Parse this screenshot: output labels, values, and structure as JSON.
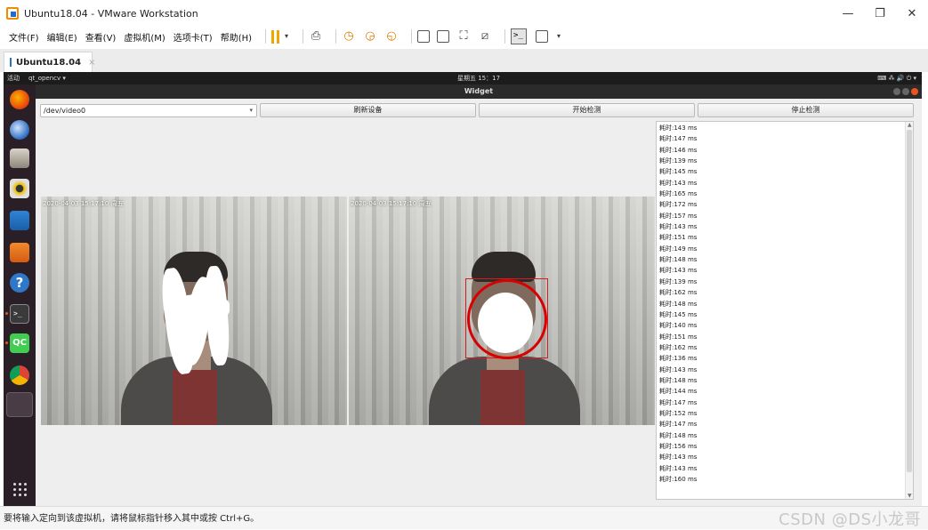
{
  "vmware": {
    "title": "Ubuntu18.04 - VMware Workstation",
    "menu": [
      "文件(F)",
      "编辑(E)",
      "查看(V)",
      "虚拟机(M)",
      "选项卡(T)",
      "帮助(H)"
    ],
    "tab_label": "Ubuntu18.04",
    "tab_close": "×",
    "minimize": "—",
    "restore": "❐",
    "close": "✕"
  },
  "gnome": {
    "activities": "活动",
    "app_menu": "qt_opencv ▾",
    "clock": "星期五 15：17",
    "status_icons": "⌨ ⁂ 🔊 ⏻ ▾"
  },
  "app": {
    "window_title": "Widget",
    "device_path": "/dev/video0",
    "refresh_button": "刷新设备",
    "start_button": "开始检测",
    "stop_button": "停止检测",
    "left_timestamp": "2020-04-03 15:17:10 周五",
    "right_timestamp": "2020-04-03 15:17:10 周五",
    "log_lines": [
      "耗时:143 ms",
      "耗时:147 ms",
      "耗时:146 ms",
      "耗时:139 ms",
      "耗时:145 ms",
      "耗时:143 ms",
      "耗时:165 ms",
      "耗时:172 ms",
      "耗时:157 ms",
      "耗时:143 ms",
      "耗时:151 ms",
      "耗时:149 ms",
      "耗时:148 ms",
      "耗时:143 ms",
      "耗时:139 ms",
      "耗时:162 ms",
      "耗时:148 ms",
      "耗时:145 ms",
      "耗时:140 ms",
      "耗时:151 ms",
      "耗时:162 ms",
      "耗时:136 ms",
      "耗时:143 ms",
      "耗时:148 ms",
      "耗时:144 ms",
      "耗时:147 ms",
      "耗时:152 ms",
      "耗时:147 ms",
      "耗时:148 ms",
      "耗时:156 ms",
      "耗时:143 ms",
      "耗时:143 ms",
      "耗时:160 ms"
    ]
  },
  "status_bar": {
    "text": "要将输入定向到该虚拟机，请将鼠标指针移入其中或按 Ctrl+G。",
    "watermark": "CSDN @DS小龙哥"
  },
  "colors": {
    "detection": "#d80000",
    "ubuntu_accent": "#e95420",
    "pause_orange": "#f0a500"
  }
}
